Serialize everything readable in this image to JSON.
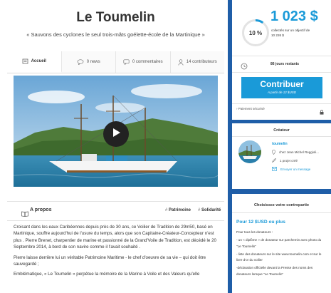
{
  "project": {
    "title": "Le Toumelin",
    "subtitle": "« Sauvons des cyclones le seul trois-mâts goélette-école de la Martinique »"
  },
  "tabs": [
    {
      "label": "Accueil",
      "icon": "home-icon"
    },
    {
      "label": "0 news",
      "icon": "chat-bubble-icon"
    },
    {
      "label": "0 commentaires",
      "icon": "comment-icon"
    },
    {
      "label": "14 contributeurs",
      "icon": "user-icon"
    }
  ],
  "video": {
    "play_icon": "play-icon"
  },
  "about": {
    "label": "A propos",
    "tag1": "Patrimoine",
    "tag2": "Solidarité"
  },
  "description": [
    "Croisant dans les eaux Caribéennes depuis près de 30 ans, ce Voilier de Tradition de 29m50, basé en Martinique, souffre aujourd'hui de l'usure du temps, alors que son Capitaine-Créateur-Concepteur n'est plus . Pierre Brenet, charpentier de marine et passionné de la Grand'Voile de Tradition, est décédé le 20 Septembre 2014, à bord de son navire comme il l'avait souhaité .",
    "Pierre laisse derrière lui un véritable Patrimoine Maritime - le chef d'oeuvre de sa vie – qui doit être sauvegardé ;",
    "Emblématique, « Le Toumelin » perpétue la mémoire de la Marine à Voile et des Valeurs qu'elle"
  ],
  "funding": {
    "percent": "10 %",
    "percent_value": 10,
    "amount": "1 023 $",
    "goal_line1": "collectés sur un objectif de",
    "goal_line2": "10 226 $",
    "days": "86 jours restants",
    "days_icon": "clock-icon"
  },
  "cta": {
    "label": "Contribuer",
    "sublabel": "A partir de 12 $USD"
  },
  "payment": {
    "label": "Paiement sécurisé",
    "icon": "lock-icon"
  },
  "creator": {
    "heading": "Créateur",
    "name": "toumelin",
    "line1": "chez Jean Michel Reggioli...",
    "line2": "1 projet créé",
    "line3": "Envoyer un message"
  },
  "reward": {
    "heading": "Choisissez votre contrepartie",
    "title": "Pour 12 $USD ou plus",
    "lines": [
      "Pour tous les donateurs :",
      "- un « diplôme » de donateur sur parchemin avec photo du \"Le Toumelin\"",
      "- liste des donateurs sur le site www.toumelin.com et sur le livre d'or du voilier",
      "-déclaration officielle devant la Presse des noms des donateurs lorsque \"Le Toumelin\""
    ]
  },
  "colors": {
    "accent": "#1a9ad8",
    "sidebar": "#1f5ea8"
  }
}
